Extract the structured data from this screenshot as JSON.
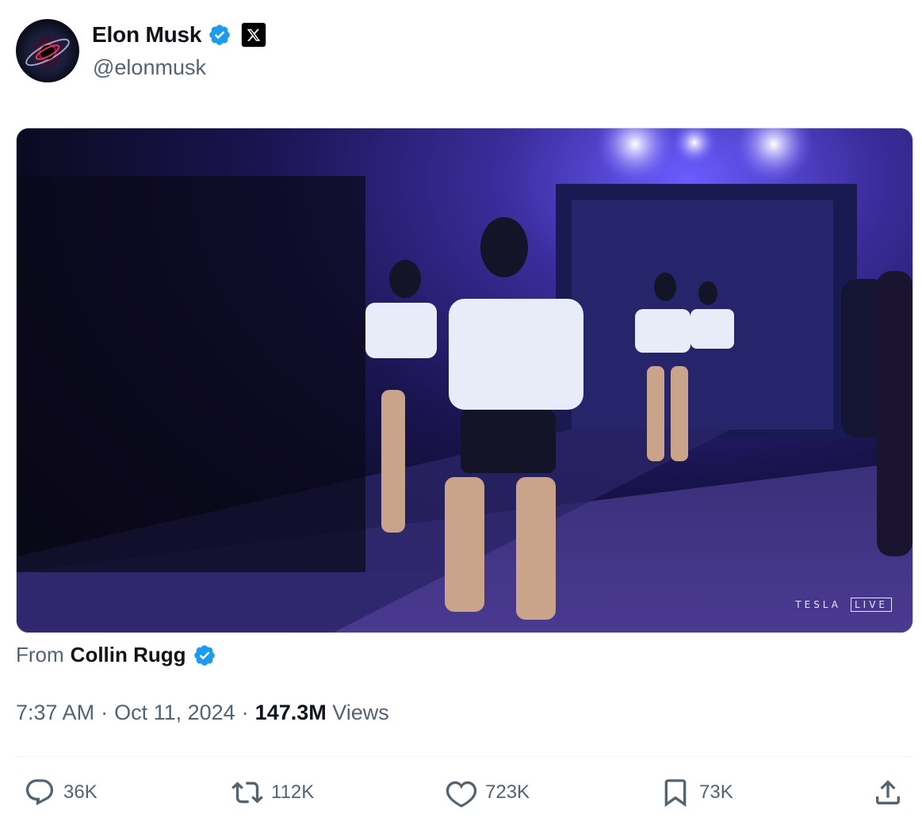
{
  "author": {
    "name": "Elon Musk",
    "handle": "@elonmusk",
    "verified_icon": "verified-badge-icon",
    "affiliation_icon": "x-logo-icon"
  },
  "media": {
    "type": "video",
    "watermark_brand": "TESLA",
    "watermark_live": "LIVE"
  },
  "source": {
    "prefix": "From",
    "name": "Collin Rugg"
  },
  "meta": {
    "time": "7:37 AM",
    "separator": "·",
    "date": "Oct 11, 2024",
    "views_count": "147.3M",
    "views_label": "Views"
  },
  "actions": {
    "reply": "36K",
    "repost": "112K",
    "like": "723K",
    "bookmark": "73K"
  },
  "colors": {
    "verified": "#1d9bf0",
    "text_primary": "#0f1419",
    "text_secondary": "#536471"
  }
}
